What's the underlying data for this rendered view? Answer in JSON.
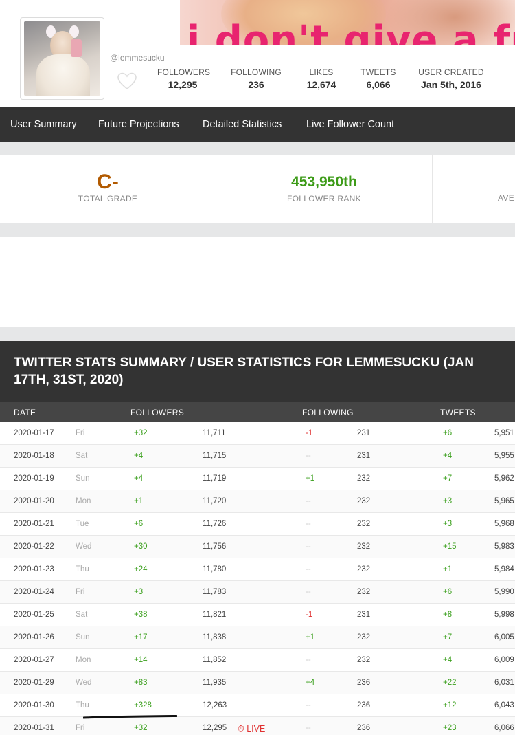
{
  "header": {
    "banner_text": "i don't give a fuc",
    "handle": "@lemmesucku",
    "stats": [
      {
        "label": "FOLLOWERS",
        "value": "12,295"
      },
      {
        "label": "FOLLOWING",
        "value": "236"
      },
      {
        "label": "LIKES",
        "value": "12,674"
      },
      {
        "label": "TWEETS",
        "value": "6,066"
      },
      {
        "label": "USER CREATED",
        "value": "Jan 5th, 2016"
      }
    ]
  },
  "nav": {
    "items": [
      "User Summary",
      "Future Projections",
      "Detailed Statistics",
      "Live Follower Count"
    ]
  },
  "grades": {
    "total": {
      "value": "C-",
      "label": "TOTAL GRADE"
    },
    "rank": {
      "value": "453,950th",
      "label": "FOLLOWER RANK"
    },
    "third_label": "AVE"
  },
  "table": {
    "title": "TWITTER STATS SUMMARY / USER STATISTICS FOR LEMMESUCKU (JAN 17TH, 31ST, 2020)",
    "columns": [
      "DATE",
      "FOLLOWERS",
      "FOLLOWING",
      "TWEETS"
    ],
    "live_label": "LIVE",
    "rows": [
      {
        "date": "2020-01-17",
        "day": "Fri",
        "followers_delta": "+32",
        "followers": "11,711",
        "following_delta": "-1",
        "following": "231",
        "tweets_delta": "+6",
        "tweets": "5,951"
      },
      {
        "date": "2020-01-18",
        "day": "Sat",
        "followers_delta": "+4",
        "followers": "11,715",
        "following_delta": "--",
        "following": "231",
        "tweets_delta": "+4",
        "tweets": "5,955"
      },
      {
        "date": "2020-01-19",
        "day": "Sun",
        "followers_delta": "+4",
        "followers": "11,719",
        "following_delta": "+1",
        "following": "232",
        "tweets_delta": "+7",
        "tweets": "5,962"
      },
      {
        "date": "2020-01-20",
        "day": "Mon",
        "followers_delta": "+1",
        "followers": "11,720",
        "following_delta": "--",
        "following": "232",
        "tweets_delta": "+3",
        "tweets": "5,965"
      },
      {
        "date": "2020-01-21",
        "day": "Tue",
        "followers_delta": "+6",
        "followers": "11,726",
        "following_delta": "--",
        "following": "232",
        "tweets_delta": "+3",
        "tweets": "5,968"
      },
      {
        "date": "2020-01-22",
        "day": "Wed",
        "followers_delta": "+30",
        "followers": "11,756",
        "following_delta": "--",
        "following": "232",
        "tweets_delta": "+15",
        "tweets": "5,983"
      },
      {
        "date": "2020-01-23",
        "day": "Thu",
        "followers_delta": "+24",
        "followers": "11,780",
        "following_delta": "--",
        "following": "232",
        "tweets_delta": "+1",
        "tweets": "5,984"
      },
      {
        "date": "2020-01-24",
        "day": "Fri",
        "followers_delta": "+3",
        "followers": "11,783",
        "following_delta": "--",
        "following": "232",
        "tweets_delta": "+6",
        "tweets": "5,990"
      },
      {
        "date": "2020-01-25",
        "day": "Sat",
        "followers_delta": "+38",
        "followers": "11,821",
        "following_delta": "-1",
        "following": "231",
        "tweets_delta": "+8",
        "tweets": "5,998"
      },
      {
        "date": "2020-01-26",
        "day": "Sun",
        "followers_delta": "+17",
        "followers": "11,838",
        "following_delta": "+1",
        "following": "232",
        "tweets_delta": "+7",
        "tweets": "6,005"
      },
      {
        "date": "2020-01-27",
        "day": "Mon",
        "followers_delta": "+14",
        "followers": "11,852",
        "following_delta": "--",
        "following": "232",
        "tweets_delta": "+4",
        "tweets": "6,009"
      },
      {
        "date": "2020-01-29",
        "day": "Wed",
        "followers_delta": "+83",
        "followers": "11,935",
        "following_delta": "+4",
        "following": "236",
        "tweets_delta": "+22",
        "tweets": "6,031"
      },
      {
        "date": "2020-01-30",
        "day": "Thu",
        "followers_delta": "+328",
        "followers": "12,263",
        "following_delta": "--",
        "following": "236",
        "tweets_delta": "+12",
        "tweets": "6,043"
      },
      {
        "date": "2020-01-31",
        "day": "Fri",
        "followers_delta": "+32",
        "followers": "12,295",
        "following_delta": "--",
        "following": "236",
        "tweets_delta": "+23",
        "tweets": "6,066",
        "live": true
      }
    ]
  },
  "colors": {
    "dark_bar": "#333333",
    "positive": "#3a9f1c",
    "negative": "#e03030",
    "grade": "#b25a00",
    "rank": "#3d9b18",
    "banner_text": "#e8246f"
  },
  "icons": [
    "heart-icon",
    "clock-icon"
  ]
}
